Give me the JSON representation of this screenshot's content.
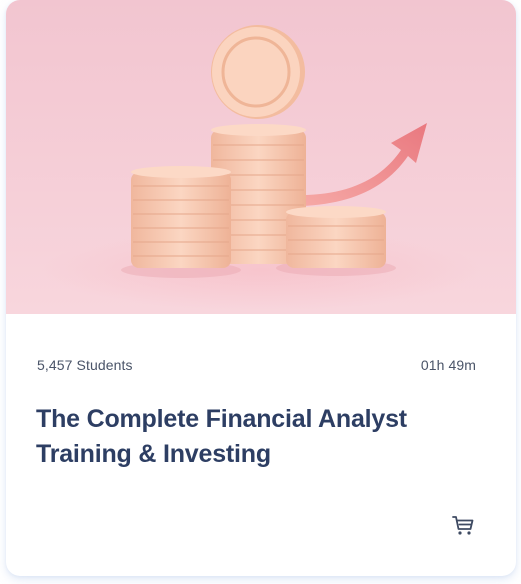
{
  "course": {
    "students": "5,457 Students",
    "duration": "01h 49m",
    "title": "The Complete Financial Analyst Training & Investing"
  },
  "icons": {
    "thumbnail": "coins-growth-arrow-illustration",
    "cart": "shopping-cart-icon"
  },
  "colors": {
    "title": "#2d3e63",
    "meta_text": "#4a5468",
    "thumbnail_bg": "#f5c9d3",
    "coin": "#f8c9b0",
    "arrow": "#ee8b8f"
  }
}
